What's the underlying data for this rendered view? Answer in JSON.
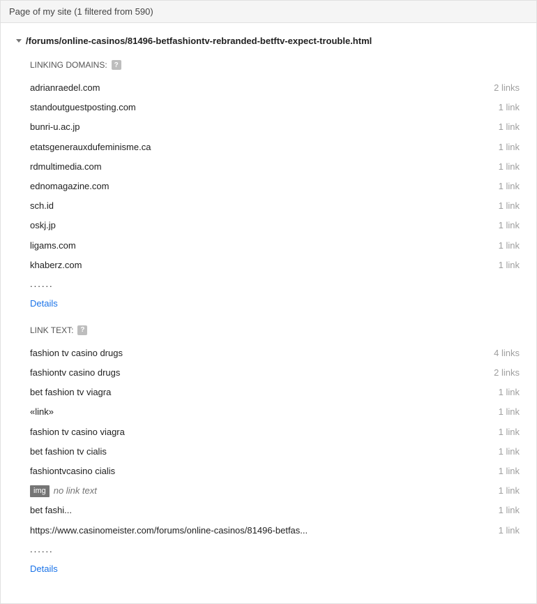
{
  "header": {
    "title": "Page of my site (1 filtered from 590)"
  },
  "page_url": "/forums/online-casinos/81496-betfashiontv-rebranded-betftv-expect-trouble.html",
  "sections": {
    "linking_domains": {
      "heading": "LINKING DOMAINS:",
      "rows": [
        {
          "label": "adrianraedel.com",
          "count": "2 links"
        },
        {
          "label": "standoutguestposting.com",
          "count": "1 link"
        },
        {
          "label": "bunri-u.ac.jp",
          "count": "1 link"
        },
        {
          "label": "etatsgenerauxdufeminisme.ca",
          "count": "1 link"
        },
        {
          "label": "rdmultimedia.com",
          "count": "1 link"
        },
        {
          "label": "ednomagazine.com",
          "count": "1 link"
        },
        {
          "label": "sch.id",
          "count": "1 link"
        },
        {
          "label": "oskj.jp",
          "count": "1 link"
        },
        {
          "label": "ligams.com",
          "count": "1 link"
        },
        {
          "label": "khaberz.com",
          "count": "1 link"
        }
      ],
      "ellipsis": "......",
      "details": "Details"
    },
    "link_text": {
      "heading": "LINK TEXT:",
      "rows": [
        {
          "label": "fashion tv casino drugs",
          "count": "4 links"
        },
        {
          "label": "fashiontv casino drugs",
          "count": "2 links"
        },
        {
          "label": "bet fashion tv viagra",
          "count": "1 link"
        },
        {
          "label": "«link»",
          "count": "1 link"
        },
        {
          "label": "fashion tv casino viagra",
          "count": "1 link"
        },
        {
          "label": "bet fashion tv cialis",
          "count": "1 link"
        },
        {
          "label": "fashiontvcasino cialis",
          "count": "1 link"
        },
        {
          "img_badge": "img",
          "italic_label": "no link text",
          "count": "1 link"
        },
        {
          "label": "bet fashi...",
          "count": "1 link"
        },
        {
          "label": "https://www.casinomeister.com/forums/online-casinos/81496-betfas...",
          "count": "1 link"
        }
      ],
      "ellipsis": "......",
      "details": "Details"
    }
  },
  "help_glyph": "?"
}
